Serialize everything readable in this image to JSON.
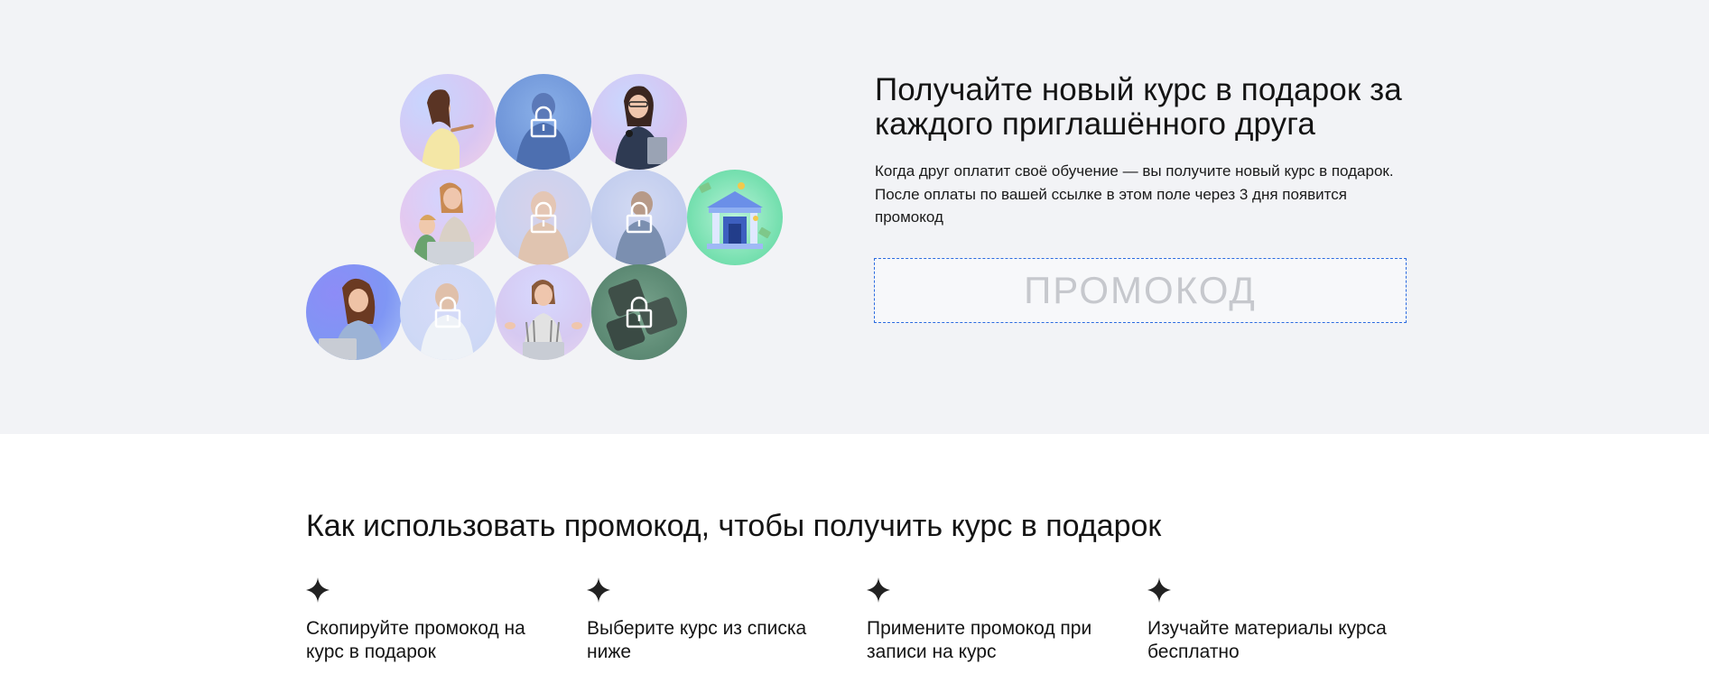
{
  "hero": {
    "title": "Получайте новый курс в подарок за каждого приглашённого друга",
    "description": "Когда друг оплатит своё обучение — вы получите новый курс в подарок. После оплаты по вашей ссылке в этом поле через 3 дня появится промокод",
    "promo_placeholder": "ПРОМОКОД",
    "avatars": [
      {
        "kind": "person",
        "locked": false,
        "icon": "woman-painting-avatar"
      },
      {
        "kind": "person",
        "locked": true,
        "icon": "lock-icon"
      },
      {
        "kind": "person",
        "locked": false,
        "icon": "woman-microphone-avatar"
      },
      {
        "kind": "person",
        "locked": false,
        "icon": "mother-child-laptop-avatar"
      },
      {
        "kind": "person",
        "locked": true,
        "icon": "lock-icon"
      },
      {
        "kind": "person",
        "locked": true,
        "icon": "lock-icon"
      },
      {
        "kind": "illustration",
        "locked": false,
        "icon": "bank-building-icon"
      },
      {
        "kind": "person",
        "locked": false,
        "icon": "woman-laptop-avatar"
      },
      {
        "kind": "person",
        "locked": true,
        "icon": "lock-icon"
      },
      {
        "kind": "person",
        "locked": false,
        "icon": "woman-meditating-avatar"
      },
      {
        "kind": "illustration",
        "locked": true,
        "icon": "lock-icon"
      }
    ]
  },
  "howto": {
    "title": "Как использовать промокод, чтобы получить курс в подарок",
    "steps": [
      {
        "icon": "sparkle-icon",
        "label": "Скопируйте промокод на курс в подарок"
      },
      {
        "icon": "sparkle-icon",
        "label": "Выберите курс из списка ниже"
      },
      {
        "icon": "sparkle-icon",
        "label": "Примените промокод при записи на курс"
      },
      {
        "icon": "sparkle-icon",
        "label": "Изучайте материалы курса бесплатно"
      }
    ]
  },
  "colors": {
    "hero_background": "#f2f3f6",
    "promo_border": "#2b6be0",
    "promo_text": "#c6c8cd",
    "text": "#141414"
  }
}
